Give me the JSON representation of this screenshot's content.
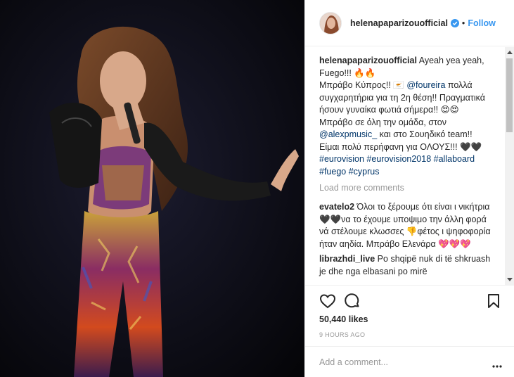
{
  "header": {
    "username": "helenapaparizouofficial",
    "separator": "•",
    "follow_label": "Follow"
  },
  "caption": {
    "username": "helenapaparizouofficial",
    "line1": " Ayeah yea yeah, Fuego!!! 🔥🔥",
    "line2a": "Μπράβο Κύπρος!! 🇨🇾 ",
    "mention1": "@foureira",
    "line2b": " πολλά συγχαρητήρια για τη 2η θέση!! Πραγματικά ήσουν γυναίκα φωτιά σήμερα!! 😍😍",
    "line3a": "Μπράβο σε όλη την ομάδα, στον ",
    "mention2": "@alexpmusic_",
    "line3b": " και στο Σουηδικό team!! Είμαι πολύ περήφανη για ΟΛΟΥΣ!!! 🖤🖤 ",
    "tags": [
      "#eurovision",
      "#eurovision2018",
      "#allaboard",
      "#fuego",
      "#cyprus"
    ]
  },
  "load_more": "Load more comments",
  "comments": [
    {
      "user": "evatelo2",
      "text": " Όλοι το ξέρουμε ότι είναι ι νικήτρια 🖤🖤να το έχουμε υποψιμο την άλλη φορά νά στέλουμε κλωσσες 👎φέτος ι ψηφοφορία ήταν αηδία. Μπράβο Ελενάρα 💖💖💖"
    },
    {
      "user": "librazhdi_live",
      "text": " Po shqipë nuk di të shkruash je dhe nga elbasani po mirë"
    }
  ],
  "likes": "50,440 likes",
  "timestamp": "9 HOURS AGO",
  "add_comment_placeholder": "Add a comment...",
  "colors": {
    "accent": "#3897f0",
    "link": "#003569",
    "muted": "#999999"
  },
  "icons": [
    "verified-badge-icon",
    "heart-icon",
    "comment-icon",
    "bookmark-icon",
    "more-options-icon"
  ]
}
